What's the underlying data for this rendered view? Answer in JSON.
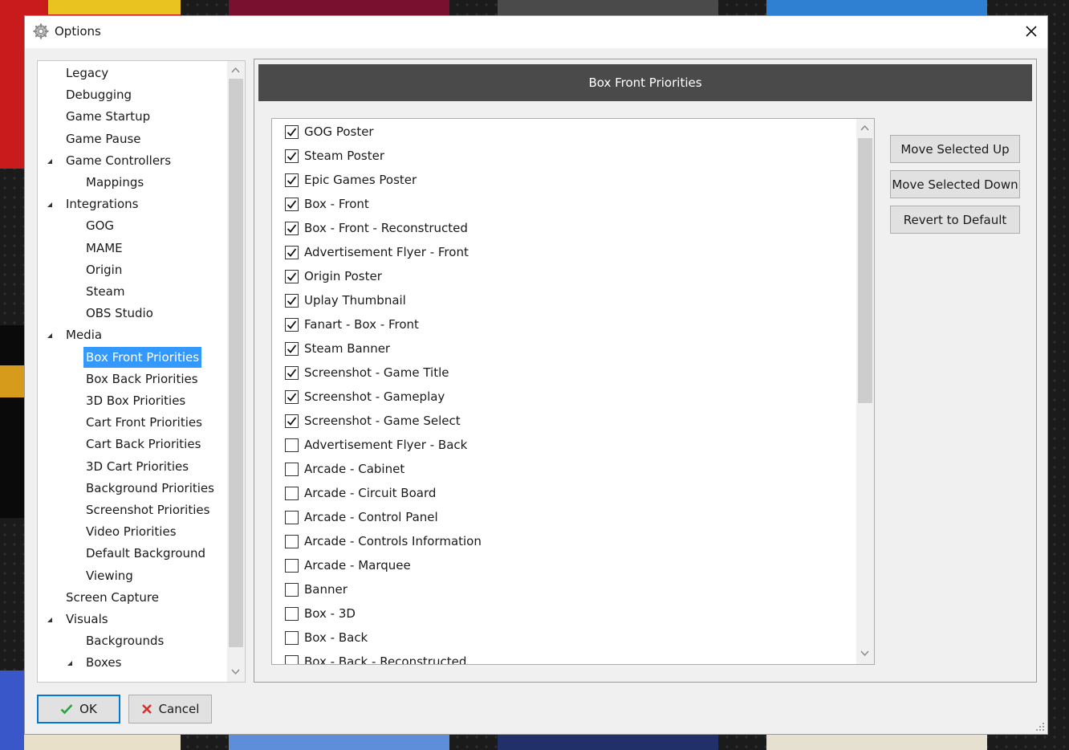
{
  "window": {
    "title": "Options"
  },
  "tree": {
    "items": [
      {
        "label": "Legacy",
        "level": 0,
        "expanded": null,
        "selected": false
      },
      {
        "label": "Debugging",
        "level": 0,
        "expanded": null,
        "selected": false
      },
      {
        "label": "Game Startup",
        "level": 0,
        "expanded": null,
        "selected": false
      },
      {
        "label": "Game Pause",
        "level": 0,
        "expanded": null,
        "selected": false
      },
      {
        "label": "Game Controllers",
        "level": 0,
        "expanded": true,
        "selected": false
      },
      {
        "label": "Mappings",
        "level": 1,
        "expanded": null,
        "selected": false
      },
      {
        "label": "Integrations",
        "level": 0,
        "expanded": true,
        "selected": false
      },
      {
        "label": "GOG",
        "level": 1,
        "expanded": null,
        "selected": false
      },
      {
        "label": "MAME",
        "level": 1,
        "expanded": null,
        "selected": false
      },
      {
        "label": "Origin",
        "level": 1,
        "expanded": null,
        "selected": false
      },
      {
        "label": "Steam",
        "level": 1,
        "expanded": null,
        "selected": false
      },
      {
        "label": "OBS Studio",
        "level": 1,
        "expanded": null,
        "selected": false
      },
      {
        "label": "Media",
        "level": 0,
        "expanded": true,
        "selected": false
      },
      {
        "label": "Box Front Priorities",
        "level": 1,
        "expanded": null,
        "selected": true
      },
      {
        "label": "Box Back Priorities",
        "level": 1,
        "expanded": null,
        "selected": false
      },
      {
        "label": "3D Box Priorities",
        "level": 1,
        "expanded": null,
        "selected": false
      },
      {
        "label": "Cart Front Priorities",
        "level": 1,
        "expanded": null,
        "selected": false
      },
      {
        "label": "Cart Back Priorities",
        "level": 1,
        "expanded": null,
        "selected": false
      },
      {
        "label": "3D Cart Priorities",
        "level": 1,
        "expanded": null,
        "selected": false
      },
      {
        "label": "Background Priorities",
        "level": 1,
        "expanded": null,
        "selected": false
      },
      {
        "label": "Screenshot Priorities",
        "level": 1,
        "expanded": null,
        "selected": false
      },
      {
        "label": "Video Priorities",
        "level": 1,
        "expanded": null,
        "selected": false
      },
      {
        "label": "Default Background",
        "level": 1,
        "expanded": null,
        "selected": false
      },
      {
        "label": "Viewing",
        "level": 1,
        "expanded": null,
        "selected": false
      },
      {
        "label": "Screen Capture",
        "level": 0,
        "expanded": null,
        "selected": false
      },
      {
        "label": "Visuals",
        "level": 0,
        "expanded": true,
        "selected": false
      },
      {
        "label": "Backgrounds",
        "level": 1,
        "expanded": null,
        "selected": false
      },
      {
        "label": "Boxes",
        "level": 1,
        "expanded": true,
        "selected": false
      }
    ]
  },
  "panel": {
    "header": "Box Front Priorities",
    "items": [
      {
        "label": "GOG Poster",
        "checked": true
      },
      {
        "label": "Steam Poster",
        "checked": true
      },
      {
        "label": "Epic Games Poster",
        "checked": true
      },
      {
        "label": "Box - Front",
        "checked": true
      },
      {
        "label": "Box - Front - Reconstructed",
        "checked": true
      },
      {
        "label": "Advertisement Flyer - Front",
        "checked": true
      },
      {
        "label": "Origin Poster",
        "checked": true
      },
      {
        "label": "Uplay Thumbnail",
        "checked": true
      },
      {
        "label": "Fanart - Box - Front",
        "checked": true
      },
      {
        "label": "Steam Banner",
        "checked": true
      },
      {
        "label": "Screenshot - Game Title",
        "checked": true
      },
      {
        "label": "Screenshot - Gameplay",
        "checked": true
      },
      {
        "label": "Screenshot - Game Select",
        "checked": true
      },
      {
        "label": "Advertisement Flyer - Back",
        "checked": false
      },
      {
        "label": "Arcade - Cabinet",
        "checked": false
      },
      {
        "label": "Arcade - Circuit Board",
        "checked": false
      },
      {
        "label": "Arcade - Control Panel",
        "checked": false
      },
      {
        "label": "Arcade - Controls Information",
        "checked": false
      },
      {
        "label": "Arcade - Marquee",
        "checked": false
      },
      {
        "label": "Banner",
        "checked": false
      },
      {
        "label": "Box - 3D",
        "checked": false
      },
      {
        "label": "Box - Back",
        "checked": false
      },
      {
        "label": "Box - Back - Reconstructed",
        "checked": false
      }
    ],
    "buttons": {
      "move_up": "Move Selected Up",
      "move_down": "Move Selected Down",
      "revert": "Revert to Default"
    }
  },
  "footer": {
    "ok": "OK",
    "cancel": "Cancel"
  },
  "colors": {
    "selection": "#3399ff",
    "header_bg": "#4a4a4a",
    "ok_check": "#2ea043",
    "cancel_x": "#d32f2f",
    "default_button_border": "#0078d7"
  },
  "icons": {
    "window": "gear-icon",
    "close": "close-icon",
    "ok": "checkmark-icon",
    "cancel": "x-icon"
  }
}
